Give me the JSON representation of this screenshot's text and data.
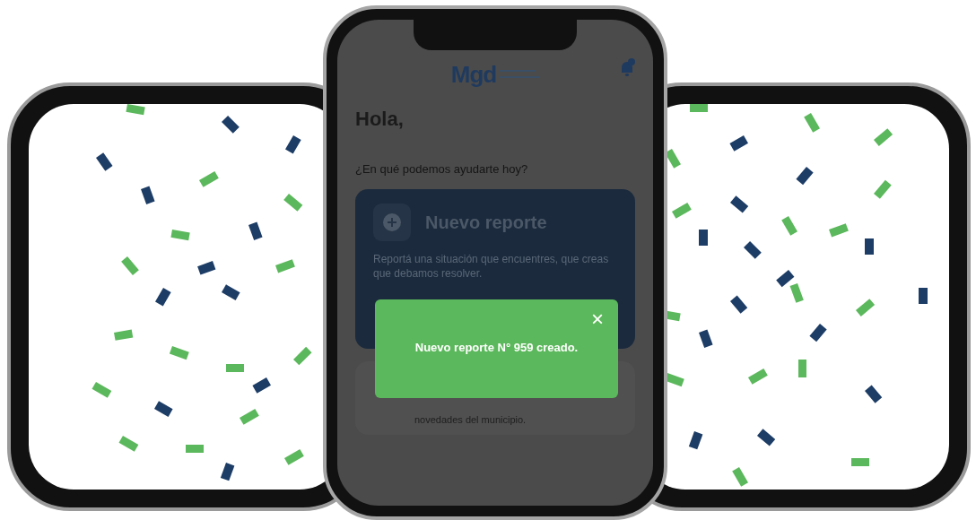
{
  "header": {
    "logo": "Mgd"
  },
  "greeting": "Hola,",
  "prompt": "¿En qué podemos ayudarte hoy?",
  "cards": [
    {
      "title": "Nuevo reporte",
      "description": "Reportá una situación que encuentres, que creas que debamos resolver."
    },
    {
      "description": "novedades del municipio."
    }
  ],
  "toast": {
    "message": "Nuevo reporte N° 959 creado.",
    "close": "×"
  }
}
